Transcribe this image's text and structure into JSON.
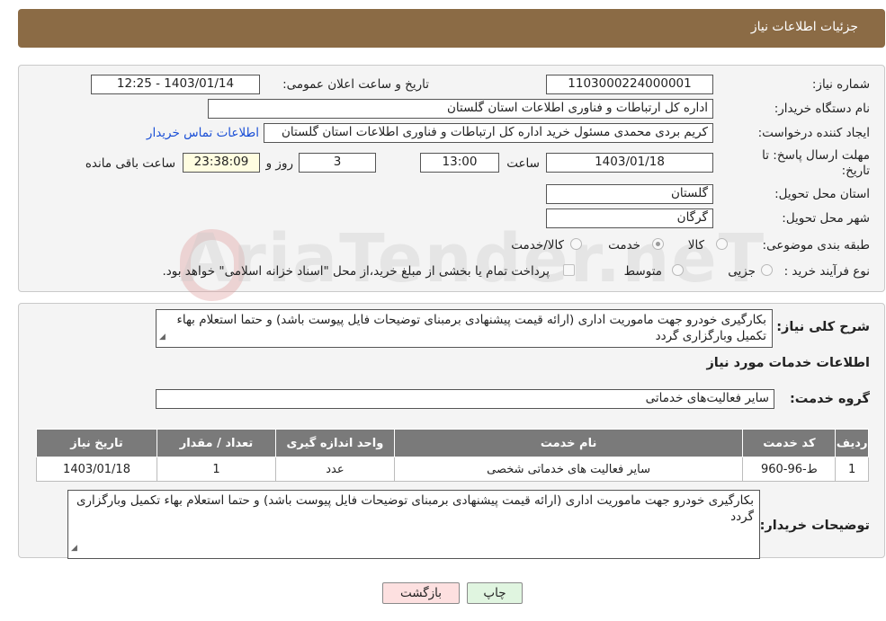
{
  "header": {
    "title": "جزئیات اطلاعات نیاز"
  },
  "form": {
    "need_number_label": "شماره نیاز:",
    "need_number": "1103000224000001",
    "announce_label": "تاریخ و ساعت اعلان عمومی:",
    "announce_value": "1403/01/14 - 12:25",
    "buyer_org_label": "نام دستگاه خریدار:",
    "buyer_org": "اداره کل ارتباطات و فناوری اطلاعات استان گلستان",
    "creator_label": "ایجاد کننده درخواست:",
    "creator": "کریم بردی محمدی مسئول خرید اداره کل ارتباطات و فناوری اطلاعات استان گلستان",
    "contact_link": "اطلاعات تماس خریدار",
    "deadline_label_line1": "مهلت ارسال پاسخ: تا",
    "deadline_label_line2": "تاریخ:",
    "deadline_date": "1403/01/18",
    "time_label": "ساعت",
    "deadline_time": "13:00",
    "days_value": "3",
    "days_label": "روز و",
    "remaining_time": "23:38:09",
    "remaining_label": "ساعت باقی مانده",
    "province_label": "استان محل تحویل:",
    "province": "گلستان",
    "city_label": "شهر محل تحویل:",
    "city": "گرگان",
    "category_label": "طبقه بندی موضوعی:",
    "category_options": [
      "کالا",
      "خدمت",
      "کالا/خدمت"
    ],
    "category_selected": "خدمت",
    "process_label": "نوع فرآیند خرید :",
    "process_options": [
      "جزیی",
      "متوسط"
    ],
    "payment_note": "پرداخت تمام یا بخشی از مبلغ خرید،از محل \"اسناد خزانه اسلامی\" خواهد بود."
  },
  "summary": {
    "label": "شرح کلی نیاز:",
    "text": "بکارگیری خودرو جهت ماموریت اداری (ارائه قیمت پیشنهادی برمبنای توضیحات فایل پیوست باشد) و حتما استعلام بهاء تکمیل وبارگزاری گردد"
  },
  "services_title": "اطلاعات خدمات مورد نیاز",
  "service_group": {
    "label": "گروه خدمت:",
    "value": "سایر فعالیت‌های خدماتی"
  },
  "table": {
    "headers": [
      "ردیف",
      "کد خدمت",
      "نام خدمت",
      "واحد اندازه گیری",
      "تعداد / مقدار",
      "تاریخ نیاز"
    ],
    "rows": [
      [
        "1",
        "ط-96-960",
        "سایر فعالیت های خدماتی شخصی",
        "عدد",
        "1",
        "1403/01/18"
      ]
    ]
  },
  "buyer_notes": {
    "label": "توضیحات خریدار:",
    "text": "بکارگیری خودرو جهت ماموریت اداری (ارائه قیمت پیشنهادی برمبنای توضیحات فایل پیوست باشد) و حتما استعلام بهاء تکمیل وبارگزاری گردد"
  },
  "buttons": {
    "print": "چاپ",
    "back": "بازگشت"
  },
  "watermark": "AriaTender.neT",
  "colors": {
    "header": "#8b6b45",
    "table_header": "#7a7a7a",
    "link": "#1a4fd6",
    "back_button": "#fde0e0",
    "print_button": "#e0f5e0"
  }
}
